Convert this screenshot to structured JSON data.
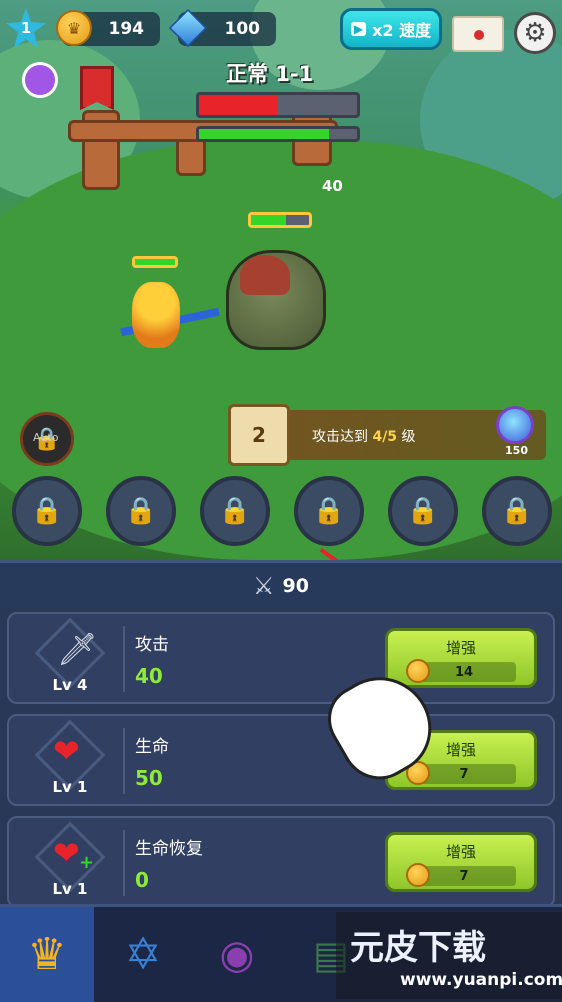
{
  "top_bar": {
    "player_level": "1",
    "coins": "194",
    "gems": "100",
    "speed_label": "x2 速度"
  },
  "stage": {
    "title": "正常 1-1",
    "enemy_count": "40",
    "boss_health_pct": 50,
    "timer_pct": 82,
    "monster_health_pct": 60
  },
  "quest": {
    "number": "2",
    "text_prefix": "攻击达到",
    "progress": "4/5",
    "text_suffix": "级",
    "reward": "150"
  },
  "auto_label": "Auto",
  "skill_slots": [
    "locked",
    "locked",
    "locked",
    "locked",
    "locked",
    "locked"
  ],
  "panel": {
    "power": "90"
  },
  "upgrades": [
    {
      "level": "Lv 4",
      "name": "攻击",
      "value": "40",
      "button": "增强",
      "cost": "14",
      "icon": "sword-icon"
    },
    {
      "level": "Lv 1",
      "name": "生命",
      "value": "50",
      "button": "增强",
      "cost": "7",
      "icon": "heart-icon"
    },
    {
      "level": "Lv 1",
      "name": "生命恢复",
      "value": "0",
      "button": "增强",
      "cost": "7",
      "icon": "heart-plus-icon"
    }
  ],
  "bottom_nav": [
    {
      "icon": "helmet-icon",
      "active": true
    },
    {
      "icon": "star-lock-icon",
      "active": false
    },
    {
      "icon": "monster-lock-icon",
      "active": false
    },
    {
      "icon": "door-icon",
      "active": false
    }
  ],
  "watermark": {
    "title": "元皮下载",
    "url": "www.yuanpi.com"
  },
  "colors": {
    "accent_green": "#8eea3a",
    "button_green": "#a8d838",
    "panel_bg": "#2a3858",
    "boss_bar_red": "#e8232a",
    "timer_bar_green": "#35d42a"
  }
}
